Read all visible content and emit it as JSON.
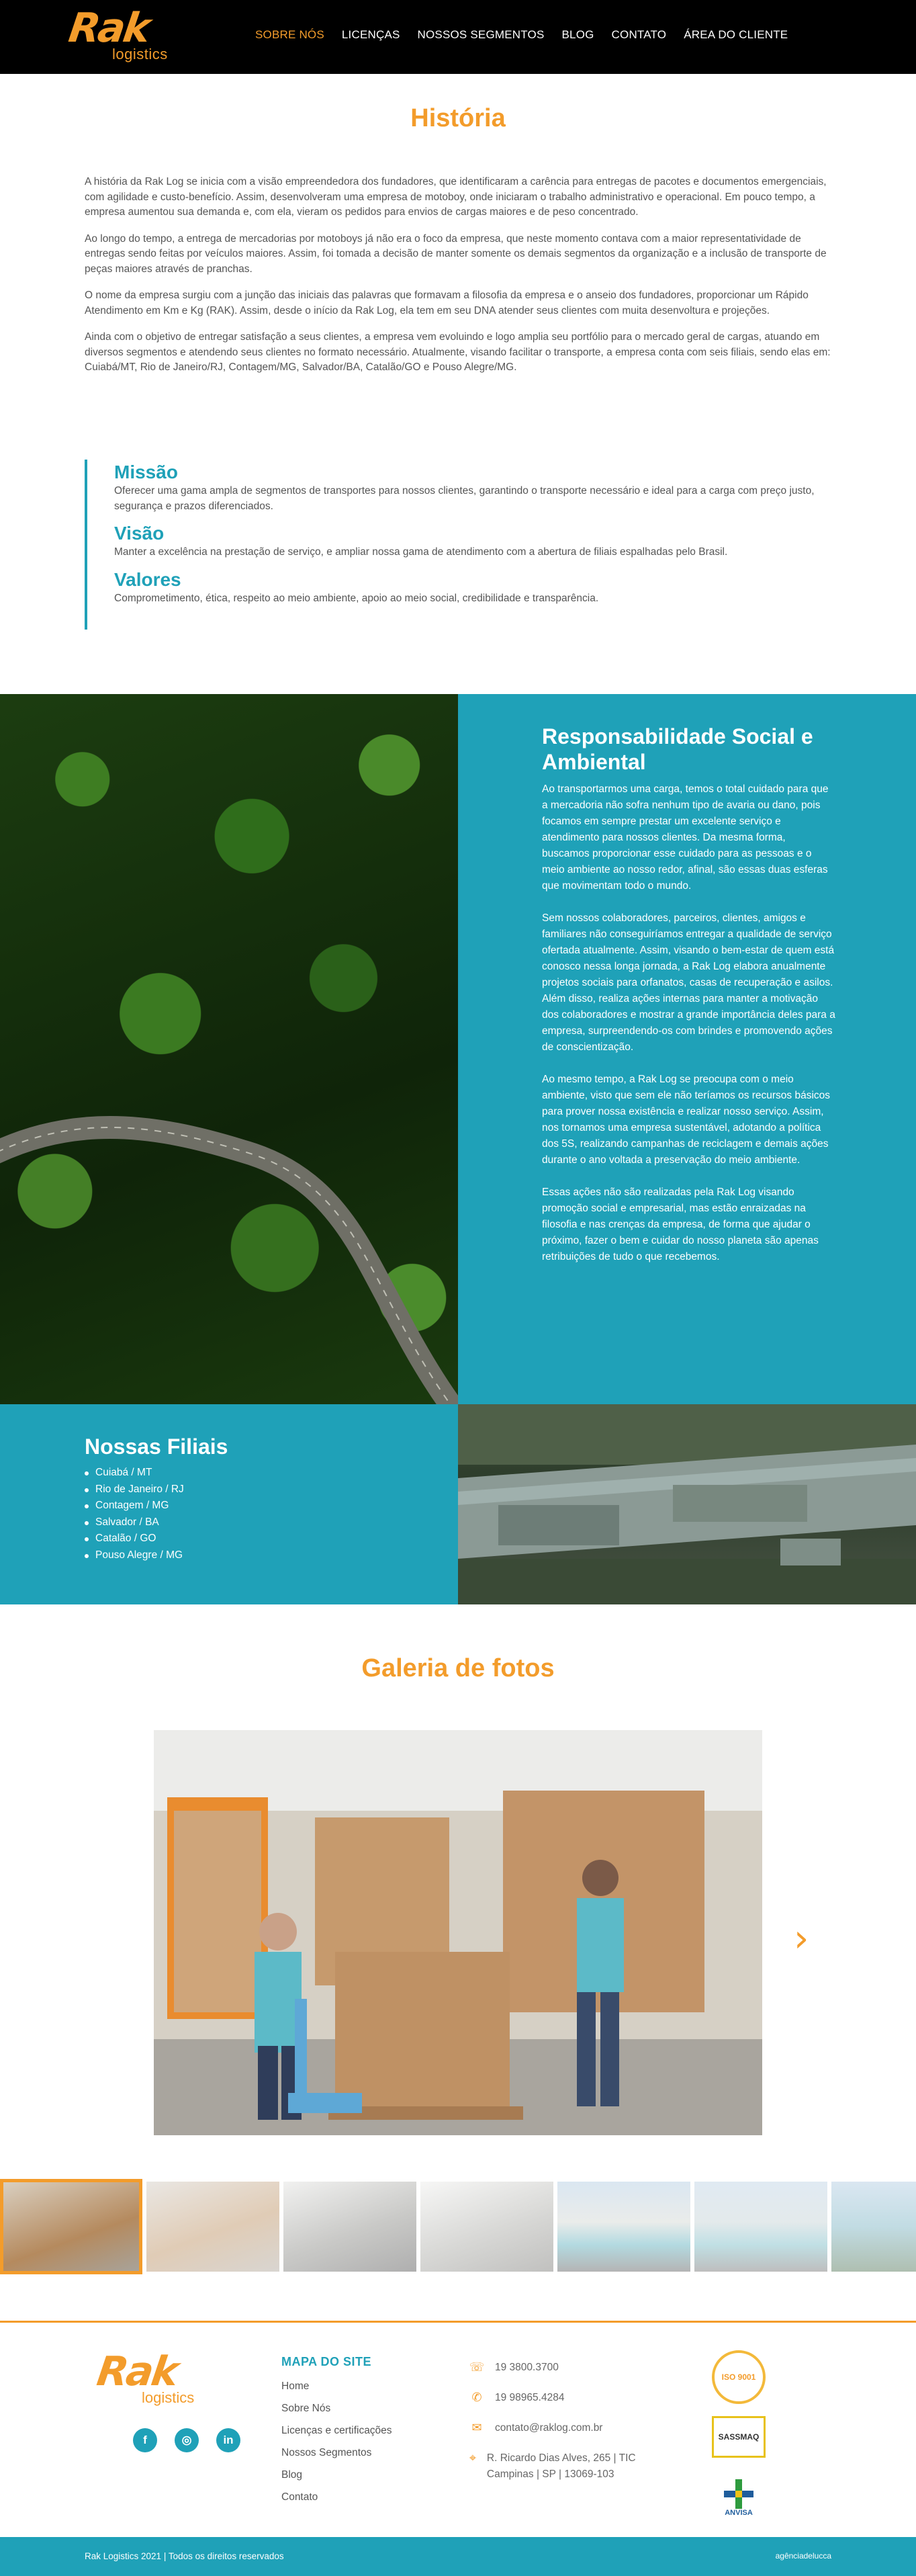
{
  "header": {
    "logo_main": "Rak",
    "logo_sub": "logistics",
    "nav": [
      {
        "label": "SOBRE NÓS"
      },
      {
        "label": "LICENÇAS"
      },
      {
        "label": "NOSSOS SEGMENTOS"
      },
      {
        "label": "BLOG"
      },
      {
        "label": "CONTATO"
      },
      {
        "label": "ÁREA DO CLIENTE"
      }
    ]
  },
  "historia": {
    "title": "História",
    "paragraphs": [
      "A história da Rak Log se inicia com a visão empreendedora dos fundadores, que identificaram a carência para entregas de pacotes e documentos emergenciais, com agilidade e custo-benefício. Assim, desenvolveram uma empresa de motoboy, onde iniciaram o trabalho administrativo e operacional. Em pouco tempo, a empresa aumentou sua demanda e, com ela, vieram os pedidos para envios de cargas maiores e de peso concentrado.",
      "Ao longo do tempo, a entrega de mercadorias por motoboys já não era o foco da empresa, que neste momento contava com a maior representatividade de entregas sendo feitas por veículos maiores. Assim, foi tomada a decisão de manter somente os demais segmentos da organização e a inclusão de transporte de peças maiores através de pranchas.",
      "O nome da empresa surgiu com a junção das iniciais das palavras que formavam a filosofia da empresa e o anseio dos fundadores, proporcionar um Rápido Atendimento em Km e Kg (RAK). Assim, desde o início da Rak Log, ela tem em seu DNA atender seus clientes com muita desenvoltura e projeções.",
      "Ainda com o objetivo de entregar satisfação a seus clientes, a empresa vem evoluindo e logo amplia seu portfólio para o mercado geral de cargas, atuando em diversos segmentos e atendendo seus clientes no formato necessário. Atualmente, visando facilitar o transporte, a empresa conta com seis filiais, sendo elas em: Cuiabá/MT, Rio de Janeiro/RJ, Contagem/MG, Salvador/BA, Catalão/GO e Pouso Alegre/MG."
    ]
  },
  "mvv": {
    "missao_title": "Missão",
    "missao_text": "Oferecer uma gama ampla de segmentos de transportes para nossos clientes, garantindo o transporte necessário e ideal para a carga com preço justo, segurança e prazos diferenciados.",
    "visao_title": "Visão",
    "visao_text": "Manter a excelência na prestação de serviço, e ampliar nossa gama de atendimento com a abertura de filiais espalhadas pelo Brasil.",
    "valores_title": "Valores",
    "valores_text": "Comprometimento, ética, respeito ao meio ambiente, apoio ao meio social, credibilidade e transparência."
  },
  "social": {
    "title": "Responsabilidade Social e Ambiental",
    "paragraphs": [
      "Ao transportarmos uma carga, temos o total cuidado para que a mercadoria não sofra nenhum tipo de avaria ou dano, pois focamos em sempre prestar um excelente serviço e atendimento para nossos clientes. Da mesma forma, buscamos proporcionar esse cuidado para as pessoas e o meio ambiente ao nosso redor, afinal, são essas duas esferas que movimentam todo o mundo.",
      "Sem nossos colaboradores, parceiros, clientes, amigos e familiares não conseguiríamos entregar a qualidade de serviço ofertada atualmente. Assim, visando o bem-estar de quem está conosco nessa longa jornada, a Rak Log elabora anualmente projetos sociais para orfanatos, casas de recuperação e asilos. Além disso, realiza ações internas para manter a motivação dos colaboradores e mostrar a grande importância deles para a empresa, surpreendendo-os com brindes e promovendo ações de conscientização.",
      "Ao mesmo tempo, a Rak Log se preocupa com o meio ambiente, visto que sem ele não teríamos os recursos básicos para prover nossa existência e realizar nosso serviço. Assim, nos tornamos uma empresa sustentável, adotando a política dos 5S, realizando campanhas de reciclagem e demais ações durante o ano voltada a preservação do meio ambiente.",
      "Essas ações não são realizadas pela Rak Log visando promoção social e empresarial, mas estão enraizadas na filosofia e nas crenças da empresa, de forma que ajudar o próximo, fazer o bem e cuidar do nosso planeta são apenas retribuições de tudo o que recebemos."
    ]
  },
  "filiais": {
    "title": "Nossas Filiais",
    "items": [
      "Cuiabá / MT",
      "Rio de Janeiro / RJ",
      "Contagem / MG",
      "Salvador / BA",
      "Catalão / GO",
      "Pouso Alegre / MG"
    ]
  },
  "galeria": {
    "title": "Galeria de fotos",
    "next_arrow": "›",
    "active_thumb": 1,
    "thumb_count": 7
  },
  "footer": {
    "logo_main": "Rak",
    "logo_sub": "logistics",
    "social_icons": [
      "facebook-icon",
      "instagram-icon",
      "linkedin-icon"
    ],
    "sitemap_title": "MAPA DO SITE",
    "sitemap_links": [
      "Home",
      "Sobre Nós",
      "Licenças e certificações",
      "Nossos Segmentos",
      "Blog",
      "Contato"
    ],
    "phone": "19 3800.3700",
    "whatsapp": "19 98965.4284",
    "email": "contato@raklog.com.br",
    "address": "R. Ricardo Dias Alves, 265 | TIC Campinas | SP | 13069-103",
    "cert_iso": "ISO 9001",
    "cert_sassmaq": "SASSMAQ",
    "cert_anvisa": "ANVISA",
    "copyright": "Rak Logistics 2021 | Todos os direitos reservados",
    "developer": "agênciadelucca"
  },
  "colors": {
    "brand_orange": "#f39c2b",
    "brand_teal": "#1fa1b8",
    "header_bg": "#000000"
  }
}
